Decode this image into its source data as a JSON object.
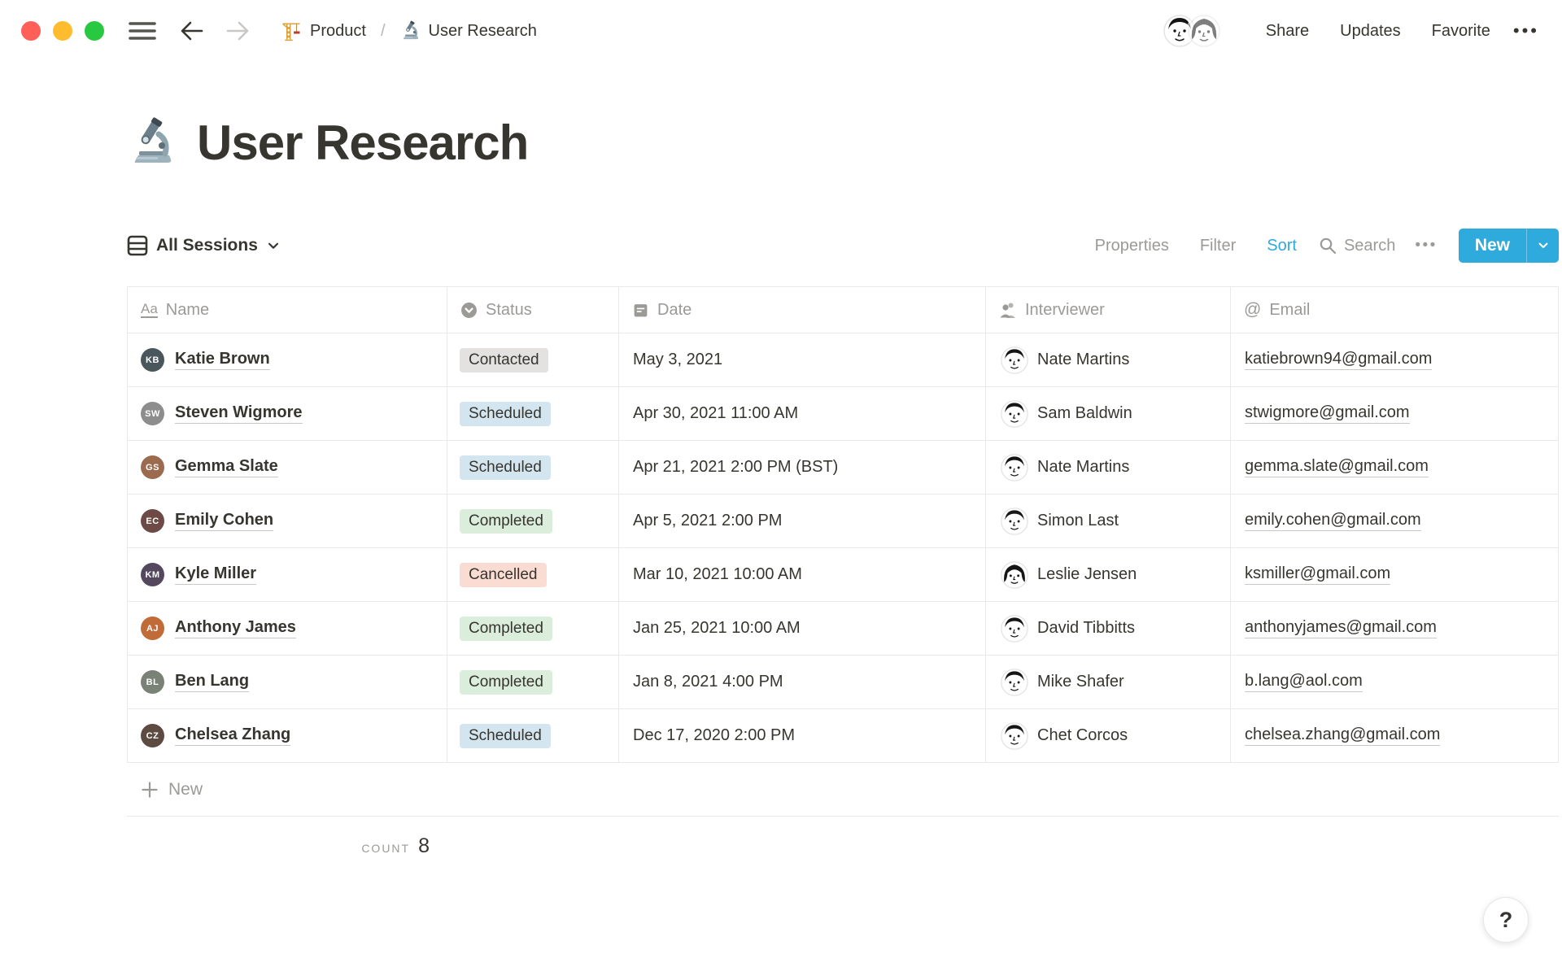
{
  "window": {
    "traffic_light_colors": [
      "#ff5f57",
      "#febc2e",
      "#28c840"
    ]
  },
  "topbar": {
    "breadcrumb": {
      "items": [
        {
          "icon": "crane-emoji",
          "label": "Product"
        },
        {
          "icon": "microscope-emoji",
          "label": "User Research"
        }
      ],
      "separator": "/"
    },
    "actions": {
      "share": "Share",
      "updates": "Updates",
      "favorite": "Favorite",
      "more": "•••"
    }
  },
  "page": {
    "icon": "microscope-emoji",
    "title": "User Research"
  },
  "view_bar": {
    "view_name": "All Sessions",
    "properties": "Properties",
    "filter": "Filter",
    "sort": "Sort",
    "search": "Search",
    "more": "•••",
    "new_label": "New",
    "accent_color": "#2eaadc"
  },
  "table": {
    "columns": [
      {
        "id": "name",
        "icon": "text-property-icon",
        "label": "Name"
      },
      {
        "id": "status",
        "icon": "select-property-icon",
        "label": "Status"
      },
      {
        "id": "date",
        "icon": "calendar-property-icon",
        "label": "Date"
      },
      {
        "id": "interviewer",
        "icon": "person-property-icon",
        "label": "Interviewer"
      },
      {
        "id": "email",
        "icon": "at-property-icon",
        "label": "Email"
      }
    ],
    "status_colors": {
      "Contacted": "#e3e2e0",
      "Scheduled": "#d3e5ef",
      "Completed": "#dbeddb",
      "Cancelled": "#fbdcd2"
    },
    "rows": [
      {
        "name": "Katie Brown",
        "initials": "KB",
        "avatar_color": "#49565c",
        "status": "Contacted",
        "date": "May 3, 2021",
        "interviewer": "Nate Martins",
        "interviewer_face": "m",
        "email": "katiebrown94@gmail.com"
      },
      {
        "name": "Steven Wigmore",
        "initials": "SW",
        "avatar_color": "#8d8d8d",
        "status": "Scheduled",
        "date": "Apr 30, 2021 11:00 AM",
        "interviewer": "Sam Baldwin",
        "interviewer_face": "m",
        "email": "stwigmore@gmail.com"
      },
      {
        "name": "Gemma Slate",
        "initials": "GS",
        "avatar_color": "#9b6a4f",
        "status": "Scheduled",
        "date": "Apr 21, 2021 2:00 PM (BST)",
        "interviewer": "Nate Martins",
        "interviewer_face": "m",
        "email": "gemma.slate@gmail.com"
      },
      {
        "name": "Emily Cohen",
        "initials": "EC",
        "avatar_color": "#6d4a45",
        "status": "Completed",
        "date": "Apr 5, 2021 2:00 PM",
        "interviewer": "Simon Last",
        "interviewer_face": "m",
        "email": "emily.cohen@gmail.com"
      },
      {
        "name": "Kyle Miller",
        "initials": "KM",
        "avatar_color": "#54485e",
        "status": "Cancelled",
        "date": "Mar 10, 2021 10:00 AM",
        "interviewer": "Leslie Jensen",
        "interviewer_face": "f",
        "email": "ksmiller@gmail.com"
      },
      {
        "name": "Anthony James",
        "initials": "AJ",
        "avatar_color": "#c06b38",
        "status": "Completed",
        "date": "Jan 25, 2021 10:00 AM",
        "interviewer": "David Tibbitts",
        "interviewer_face": "m",
        "email": "anthonyjames@gmail.com"
      },
      {
        "name": "Ben Lang",
        "initials": "BL",
        "avatar_color": "#7a8277",
        "status": "Completed",
        "date": "Jan 8, 2021 4:00 PM",
        "interviewer": "Mike Shafer",
        "interviewer_face": "m",
        "email": "b.lang@aol.com"
      },
      {
        "name": "Chelsea Zhang",
        "initials": "CZ",
        "avatar_color": "#5d4a40",
        "status": "Scheduled",
        "date": "Dec 17, 2020 2:00 PM",
        "interviewer": "Chet Corcos",
        "interviewer_face": "m",
        "email": "chelsea.zhang@gmail.com"
      }
    ],
    "footer": {
      "new_label": "New",
      "count_label": "COUNT",
      "count_value": "8"
    }
  },
  "help_button": {
    "label": "?"
  }
}
